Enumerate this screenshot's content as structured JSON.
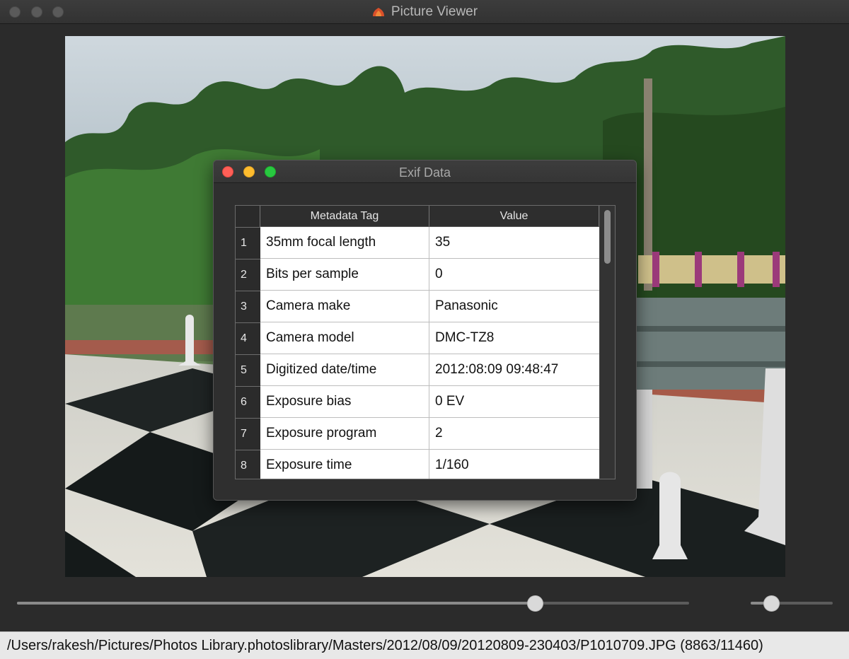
{
  "window": {
    "title": "Picture Viewer"
  },
  "dialog": {
    "title": "Exif Data",
    "table": {
      "headers": [
        "Metadata Tag",
        "Value"
      ],
      "rows": [
        {
          "index": "1",
          "tag": "35mm focal length",
          "value": "35"
        },
        {
          "index": "2",
          "tag": "Bits per sample",
          "value": "0"
        },
        {
          "index": "3",
          "tag": "Camera make",
          "value": "Panasonic"
        },
        {
          "index": "4",
          "tag": "Camera model",
          "value": "DMC-TZ8"
        },
        {
          "index": "5",
          "tag": "Digitized date/time",
          "value": "2012:08:09 09:48:47"
        },
        {
          "index": "6",
          "tag": "Exposure bias",
          "value": "0 EV"
        },
        {
          "index": "7",
          "tag": "Exposure program",
          "value": "2"
        },
        {
          "index": "8",
          "tag": "Exposure time",
          "value": "1/160"
        }
      ]
    }
  },
  "controls": {
    "position_slider": {
      "value": 0.77
    },
    "zoom_slider": {
      "value": 0.25
    }
  },
  "statusbar": {
    "path": "/Users/rakesh/Pictures/Photos Library.photoslibrary/Masters/2012/08/09/20120809-230403/P1010709.JPG (8863/11460)"
  },
  "colors": {
    "close": "#ff5f57",
    "minimize": "#febc2e",
    "maximize": "#28c840"
  }
}
